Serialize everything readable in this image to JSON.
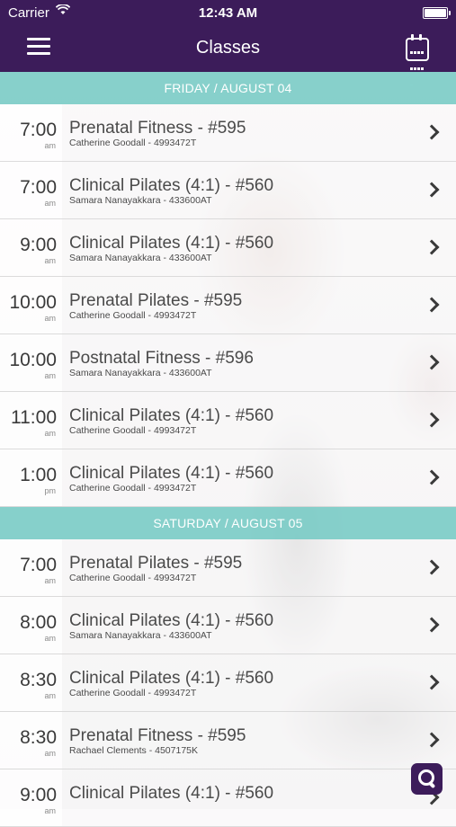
{
  "status_bar": {
    "carrier": "Carrier",
    "time": "12:43 AM"
  },
  "navbar": {
    "title": "Classes"
  },
  "icons": {
    "menu": "menu-icon",
    "calendar": "calendar-icon",
    "search": "search-icon",
    "chevron": "chevron-right-icon",
    "wifi": "wifi-icon",
    "battery": "battery-icon"
  },
  "colors": {
    "header": "#3c1c5a",
    "section": "#7ecec8"
  },
  "sections": [
    {
      "title": "FRIDAY / AUGUST 04",
      "classes": [
        {
          "time": "7:00",
          "ampm": "am",
          "name": "Prenatal Fitness - #595",
          "instructor": "Catherine Goodall - 4993472T"
        },
        {
          "time": "7:00",
          "ampm": "am",
          "name": "Clinical Pilates (4:1) - #560",
          "instructor": "Samara Nanayakkara - 433600AT"
        },
        {
          "time": "9:00",
          "ampm": "am",
          "name": "Clinical Pilates (4:1) - #560",
          "instructor": "Samara Nanayakkara - 433600AT"
        },
        {
          "time": "10:00",
          "ampm": "am",
          "name": "Prenatal Pilates - #595",
          "instructor": "Catherine Goodall - 4993472T"
        },
        {
          "time": "10:00",
          "ampm": "am",
          "name": "Postnatal Fitness - #596",
          "instructor": "Samara Nanayakkara - 433600AT"
        },
        {
          "time": "11:00",
          "ampm": "am",
          "name": "Clinical Pilates (4:1) - #560",
          "instructor": "Catherine Goodall - 4993472T"
        },
        {
          "time": "1:00",
          "ampm": "pm",
          "name": "Clinical Pilates (4:1) - #560",
          "instructor": "Catherine Goodall - 4993472T"
        }
      ]
    },
    {
      "title": "SATURDAY / AUGUST 05",
      "classes": [
        {
          "time": "7:00",
          "ampm": "am",
          "name": "Prenatal Pilates - #595",
          "instructor": "Catherine Goodall - 4993472T"
        },
        {
          "time": "8:00",
          "ampm": "am",
          "name": "Clinical Pilates (4:1) - #560",
          "instructor": "Samara Nanayakkara - 433600AT"
        },
        {
          "time": "8:30",
          "ampm": "am",
          "name": "Clinical Pilates (4:1) - #560",
          "instructor": "Catherine Goodall - 4993472T"
        },
        {
          "time": "8:30",
          "ampm": "am",
          "name": "Prenatal Fitness - #595",
          "instructor": "Rachael Clements - 4507175K"
        },
        {
          "time": "9:00",
          "ampm": "am",
          "name": "Clinical Pilates (4:1) - #560",
          "instructor": ""
        }
      ]
    }
  ]
}
